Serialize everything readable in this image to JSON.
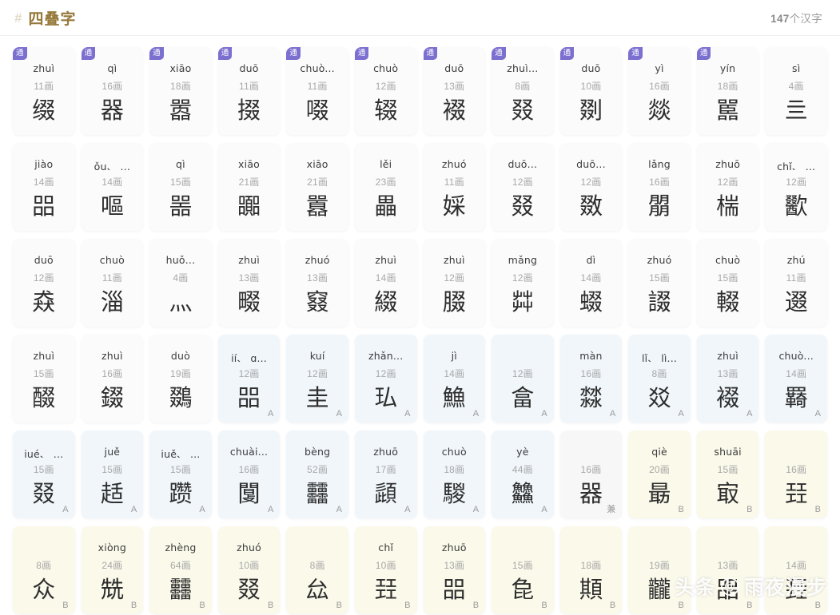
{
  "header": {
    "hash_icon": "#",
    "title": "四叠字",
    "count_number": "147",
    "count_suffix": "个汉字"
  },
  "badge_label": "通",
  "watermark": {
    "text_left": "头条",
    "at_symbol": "@",
    "text_right": "雨夜漫步"
  },
  "cards": [
    {
      "badge": "通",
      "pinyin": "zhuì",
      "strokes": "11画",
      "glyph": "缀",
      "theme": "plain",
      "mark": ""
    },
    {
      "badge": "通",
      "pinyin": "qì",
      "strokes": "16画",
      "glyph": "器",
      "theme": "plain",
      "mark": ""
    },
    {
      "badge": "通",
      "pinyin": "xiāo",
      "strokes": "18画",
      "glyph": "嚣",
      "theme": "plain",
      "mark": ""
    },
    {
      "badge": "通",
      "pinyin": "duō",
      "strokes": "11画",
      "glyph": "掇",
      "theme": "plain",
      "mark": ""
    },
    {
      "badge": "通",
      "pinyin": "chuò...",
      "strokes": "11画",
      "glyph": "啜",
      "theme": "plain",
      "mark": ""
    },
    {
      "badge": "通",
      "pinyin": "chuò",
      "strokes": "12画",
      "glyph": "辍",
      "theme": "plain",
      "mark": ""
    },
    {
      "badge": "通",
      "pinyin": "duō",
      "strokes": "13画",
      "glyph": "裰",
      "theme": "plain",
      "mark": ""
    },
    {
      "badge": "通",
      "pinyin": "zhuì...",
      "strokes": "8画",
      "glyph": "叕",
      "theme": "plain",
      "mark": ""
    },
    {
      "badge": "通",
      "pinyin": "duō",
      "strokes": "10画",
      "glyph": "剟",
      "theme": "plain",
      "mark": ""
    },
    {
      "badge": "通",
      "pinyin": "yì",
      "strokes": "16画",
      "glyph": "燚",
      "theme": "plain",
      "mark": ""
    },
    {
      "badge": "通",
      "pinyin": "yín",
      "strokes": "18画",
      "glyph": "嚚",
      "theme": "plain",
      "mark": ""
    },
    {
      "badge": "",
      "pinyin": "sì",
      "strokes": "4画",
      "glyph": "亖",
      "theme": "plain",
      "mark": ""
    },
    {
      "badge": "",
      "pinyin": "jiào",
      "strokes": "14画",
      "glyph": "㗊",
      "theme": "plain",
      "mark": ""
    },
    {
      "badge": "",
      "pinyin": "ǒu、 ...",
      "strokes": "14画",
      "glyph": "嘔",
      "theme": "plain",
      "mark": ""
    },
    {
      "badge": "",
      "pinyin": "qì",
      "strokes": "15画",
      "glyph": "噐",
      "theme": "plain",
      "mark": ""
    },
    {
      "badge": "",
      "pinyin": "xiāo",
      "strokes": "21画",
      "glyph": "嚻",
      "theme": "plain",
      "mark": ""
    },
    {
      "badge": "",
      "pinyin": "xiāo",
      "strokes": "21画",
      "glyph": "囂",
      "theme": "plain",
      "mark": ""
    },
    {
      "badge": "",
      "pinyin": "lěi",
      "strokes": "23画",
      "glyph": "畾",
      "theme": "plain",
      "mark": ""
    },
    {
      "badge": "",
      "pinyin": "zhuó",
      "strokes": "11画",
      "glyph": "婇",
      "theme": "plain",
      "mark": ""
    },
    {
      "badge": "",
      "pinyin": "duō...",
      "strokes": "12画",
      "glyph": "叕",
      "theme": "plain",
      "mark": ""
    },
    {
      "badge": "",
      "pinyin": "duō...",
      "strokes": "12画",
      "glyph": "敪",
      "theme": "plain",
      "mark": ""
    },
    {
      "badge": "",
      "pinyin": "lǎng",
      "strokes": "16画",
      "glyph": "朤",
      "theme": "plain",
      "mark": ""
    },
    {
      "badge": "",
      "pinyin": "zhuō",
      "strokes": "12画",
      "glyph": "椯",
      "theme": "plain",
      "mark": ""
    },
    {
      "badge": "",
      "pinyin": "chǐ、 ...",
      "strokes": "12画",
      "glyph": "歠",
      "theme": "plain",
      "mark": ""
    },
    {
      "badge": "",
      "pinyin": "duō",
      "strokes": "12画",
      "glyph": "猋",
      "theme": "plain",
      "mark": ""
    },
    {
      "badge": "",
      "pinyin": "chuò",
      "strokes": "11画",
      "glyph": "淄",
      "theme": "plain",
      "mark": ""
    },
    {
      "badge": "",
      "pinyin": "huǒ...",
      "strokes": "4画",
      "glyph": "灬",
      "theme": "plain",
      "mark": ""
    },
    {
      "badge": "",
      "pinyin": "zhuì",
      "strokes": "13画",
      "glyph": "畷",
      "theme": "plain",
      "mark": ""
    },
    {
      "badge": "",
      "pinyin": "zhuó",
      "strokes": "13画",
      "glyph": "窡",
      "theme": "plain",
      "mark": ""
    },
    {
      "badge": "",
      "pinyin": "zhuì",
      "strokes": "14画",
      "glyph": "綴",
      "theme": "plain",
      "mark": ""
    },
    {
      "badge": "",
      "pinyin": "zhuì",
      "strokes": "12画",
      "glyph": "腏",
      "theme": "plain",
      "mark": ""
    },
    {
      "badge": "",
      "pinyin": "mǎng",
      "strokes": "12画",
      "glyph": "茻",
      "theme": "plain",
      "mark": ""
    },
    {
      "badge": "",
      "pinyin": "dì",
      "strokes": "14画",
      "glyph": "蝃",
      "theme": "plain",
      "mark": ""
    },
    {
      "badge": "",
      "pinyin": "zhuó",
      "strokes": "15画",
      "glyph": "諁",
      "theme": "plain",
      "mark": ""
    },
    {
      "badge": "",
      "pinyin": "chuò",
      "strokes": "15画",
      "glyph": "輟",
      "theme": "plain",
      "mark": ""
    },
    {
      "badge": "",
      "pinyin": "zhú",
      "strokes": "11画",
      "glyph": "逫",
      "theme": "plain",
      "mark": ""
    },
    {
      "badge": "",
      "pinyin": "zhuì",
      "strokes": "15画",
      "glyph": "醊",
      "theme": "plain",
      "mark": ""
    },
    {
      "badge": "",
      "pinyin": "zhuì",
      "strokes": "16画",
      "glyph": "錣",
      "theme": "plain",
      "mark": ""
    },
    {
      "badge": "",
      "pinyin": "duò",
      "strokes": "19画",
      "glyph": "鵽",
      "theme": "plain",
      "mark": ""
    },
    {
      "badge": "",
      "pinyin": "jí、 q...",
      "strokes": "12画",
      "glyph": "㗊",
      "theme": "blue",
      "mark": "A"
    },
    {
      "badge": "",
      "pinyin": "kuí",
      "strokes": "12画",
      "glyph": "圭",
      "theme": "blue",
      "mark": "A"
    },
    {
      "badge": "",
      "pinyin": "zhǎn...",
      "strokes": "12画",
      "glyph": "㺨",
      "theme": "blue",
      "mark": "A"
    },
    {
      "badge": "",
      "pinyin": "jì",
      "strokes": "14画",
      "glyph": "䲆",
      "theme": "blue",
      "mark": "A"
    },
    {
      "badge": "",
      "pinyin": "",
      "strokes": "12画",
      "glyph": "畣",
      "theme": "blue",
      "mark": "A"
    },
    {
      "badge": "",
      "pinyin": "màn",
      "strokes": "16画",
      "glyph": "㵘",
      "theme": "blue",
      "mark": "A"
    },
    {
      "badge": "",
      "pinyin": "lǐ、 lì...",
      "strokes": "8画",
      "glyph": "㸚",
      "theme": "blue",
      "mark": "A"
    },
    {
      "badge": "",
      "pinyin": "zhuì",
      "strokes": "13画",
      "glyph": "裰",
      "theme": "blue",
      "mark": "A"
    },
    {
      "badge": "",
      "pinyin": "chuò...",
      "strokes": "14画",
      "glyph": "羇",
      "theme": "blue",
      "mark": "A"
    },
    {
      "badge": "",
      "pinyin": "jué、 ...",
      "strokes": "15画",
      "glyph": "叕",
      "theme": "blue",
      "mark": "A"
    },
    {
      "badge": "",
      "pinyin": "juě",
      "strokes": "15画",
      "glyph": "趏",
      "theme": "blue",
      "mark": "A"
    },
    {
      "badge": "",
      "pinyin": "juě、 ...",
      "strokes": "15画",
      "glyph": "躜",
      "theme": "blue",
      "mark": "A"
    },
    {
      "badge": "",
      "pinyin": "chuài...",
      "strokes": "16画",
      "glyph": "闅",
      "theme": "blue",
      "mark": "A"
    },
    {
      "badge": "",
      "pinyin": "bèng",
      "strokes": "52画",
      "glyph": "䨻",
      "theme": "blue",
      "mark": "A"
    },
    {
      "badge": "",
      "pinyin": "zhuō",
      "strokes": "17画",
      "glyph": "頿",
      "theme": "blue",
      "mark": "A"
    },
    {
      "badge": "",
      "pinyin": "chuò",
      "strokes": "18画",
      "glyph": "騣",
      "theme": "blue",
      "mark": "A"
    },
    {
      "badge": "",
      "pinyin": "yè",
      "strokes": "44画",
      "glyph": "䲜",
      "theme": "blue",
      "mark": "A"
    },
    {
      "badge": "",
      "pinyin": "",
      "strokes": "16画",
      "glyph": "器",
      "theme": "gray",
      "mark": "兼"
    },
    {
      "badge": "",
      "pinyin": "qiè",
      "strokes": "20画",
      "glyph": "朂",
      "theme": "cream",
      "mark": "B"
    },
    {
      "badge": "",
      "pinyin": "shuāi",
      "strokes": "15画",
      "glyph": "㝡",
      "theme": "cream",
      "mark": "B"
    },
    {
      "badge": "",
      "pinyin": "",
      "strokes": "16画",
      "glyph": "㠭",
      "theme": "cream",
      "mark": "B"
    },
    {
      "badge": "",
      "pinyin": "",
      "strokes": "8画",
      "glyph": "众",
      "theme": "cream",
      "mark": "B"
    },
    {
      "badge": "",
      "pinyin": "xiòng",
      "strokes": "24画",
      "glyph": "兟",
      "theme": "cream",
      "mark": "B"
    },
    {
      "badge": "",
      "pinyin": "zhèng",
      "strokes": "64画",
      "glyph": "䨻",
      "theme": "cream",
      "mark": "B"
    },
    {
      "badge": "",
      "pinyin": "zhuó",
      "strokes": "10画",
      "glyph": "叕",
      "theme": "cream",
      "mark": "B"
    },
    {
      "badge": "",
      "pinyin": "",
      "strokes": "8画",
      "glyph": "厽",
      "theme": "cream",
      "mark": "B"
    },
    {
      "badge": "",
      "pinyin": "chǐ",
      "strokes": "10画",
      "glyph": "㠭",
      "theme": "cream",
      "mark": "B"
    },
    {
      "badge": "",
      "pinyin": "zhuō",
      "strokes": "13画",
      "glyph": "㗊",
      "theme": "cream",
      "mark": "B"
    },
    {
      "badge": "",
      "pinyin": "",
      "strokes": "15画",
      "glyph": "㲋",
      "theme": "cream",
      "mark": "B"
    },
    {
      "badge": "",
      "pinyin": "",
      "strokes": "18画",
      "glyph": "䫏",
      "theme": "cream",
      "mark": "B"
    },
    {
      "badge": "",
      "pinyin": "",
      "strokes": "19画",
      "glyph": "龖",
      "theme": "cream",
      "mark": "B"
    },
    {
      "badge": "",
      "pinyin": "",
      "strokes": "13画",
      "glyph": "㗊",
      "theme": "cream",
      "mark": "B"
    },
    {
      "badge": "",
      "pinyin": "",
      "strokes": "14画",
      "glyph": "㠭",
      "theme": "cream",
      "mark": "B"
    }
  ]
}
